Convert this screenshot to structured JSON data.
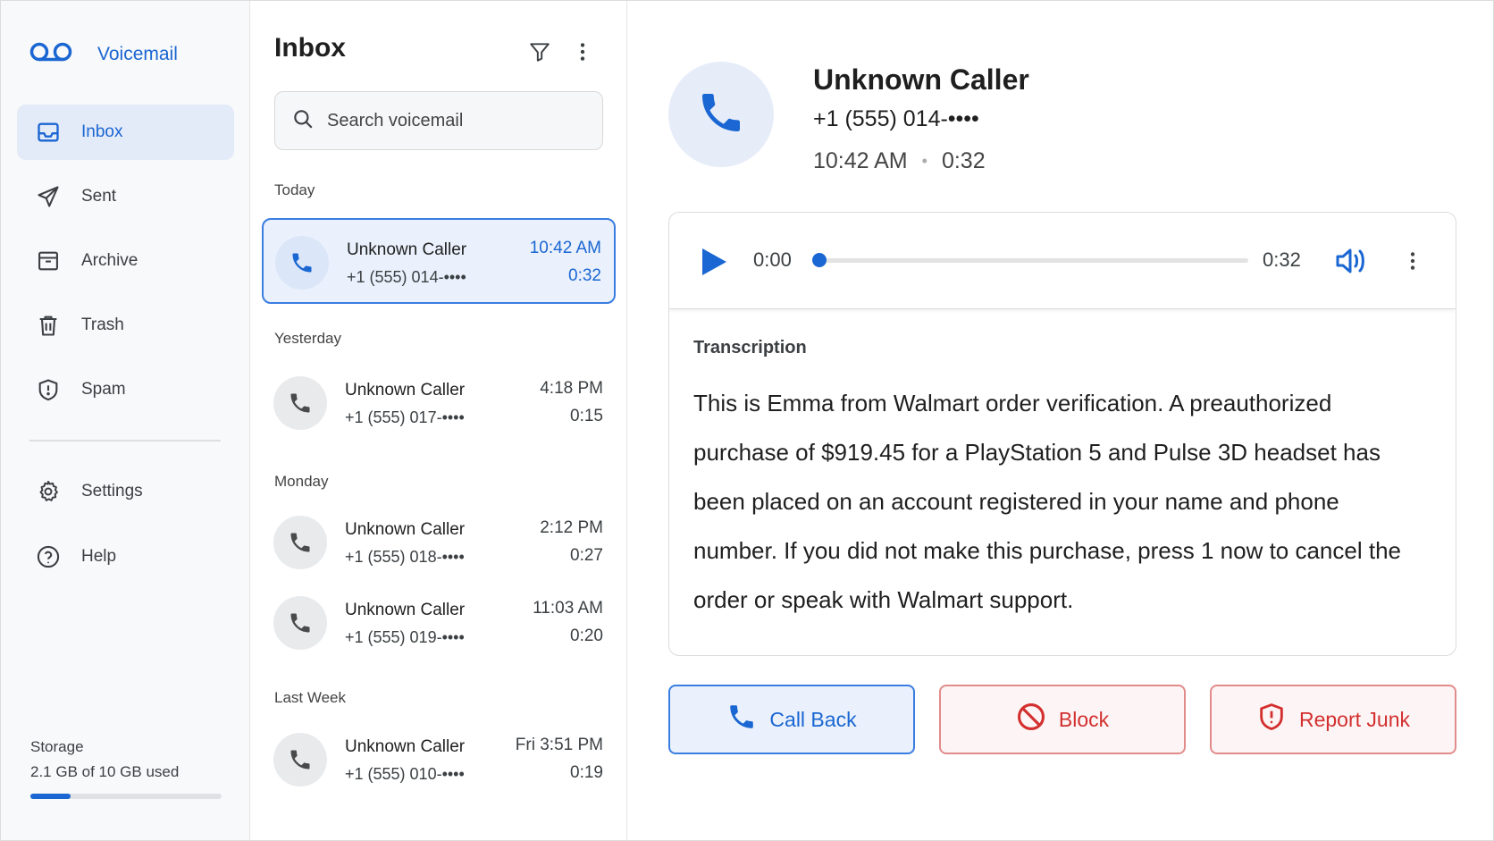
{
  "app": {
    "name": "Voicemail",
    "accent": "#1a66d2",
    "danger": "#d32f2f"
  },
  "sidebar": {
    "items": [
      {
        "label": "Inbox",
        "icon": "inbox-icon"
      },
      {
        "label": "Sent",
        "icon": "send-icon"
      },
      {
        "label": "Archive",
        "icon": "archive-icon"
      },
      {
        "label": "Trash",
        "icon": "trash-icon"
      },
      {
        "label": "Spam",
        "icon": "shield-alert-icon"
      }
    ],
    "secondary": [
      {
        "label": "Settings",
        "icon": "gear-icon"
      },
      {
        "label": "Help",
        "icon": "help-icon"
      }
    ],
    "storage": {
      "label": "Storage",
      "usage": "2.1 GB of 10 GB used",
      "fraction": 0.21
    }
  },
  "list": {
    "title": "Inbox",
    "search_placeholder": "Search voicemail",
    "groups": [
      {
        "label": "Today"
      },
      {
        "label": "Yesterday"
      },
      {
        "label": "Monday"
      },
      {
        "label": "Last Week"
      }
    ],
    "items": [
      {
        "name": "Unknown Caller",
        "number": "+1 (555) 014-••••",
        "time": "10:42 AM",
        "duration": "0:32"
      },
      {
        "name": "Unknown Caller",
        "number": "+1 (555) 017-••••",
        "time": "4:18 PM",
        "duration": "0:15"
      },
      {
        "name": "Unknown Caller",
        "number": "+1 (555) 018-••••",
        "time": "2:12 PM",
        "duration": "0:27"
      },
      {
        "name": "Unknown Caller",
        "number": "+1 (555) 019-••••",
        "time": "11:03 AM",
        "duration": "0:20"
      },
      {
        "name": "Unknown Caller",
        "number": "+1 (555) 010-••••",
        "time": "Fri 3:51 PM",
        "duration": "0:19"
      }
    ]
  },
  "detail": {
    "name": "Unknown Caller",
    "number": "+1 (555) 014-••••",
    "time": "10:42 AM",
    "separator": "•",
    "duration": "0:32",
    "player": {
      "current": "0:00",
      "total": "0:32",
      "progress": 0
    },
    "transcription_label": "Transcription",
    "transcription": "This is Emma from Walmart order verification. A preauthorized purchase of $919.45 for a PlayStation 5 and Pulse 3D headset has been placed on an account registered in your name and phone number. If you did not make this purchase, press 1 now to cancel the order or speak with Walmart support.",
    "actions": {
      "call_back": "Call Back",
      "block": "Block",
      "report_junk": "Report Junk"
    }
  }
}
